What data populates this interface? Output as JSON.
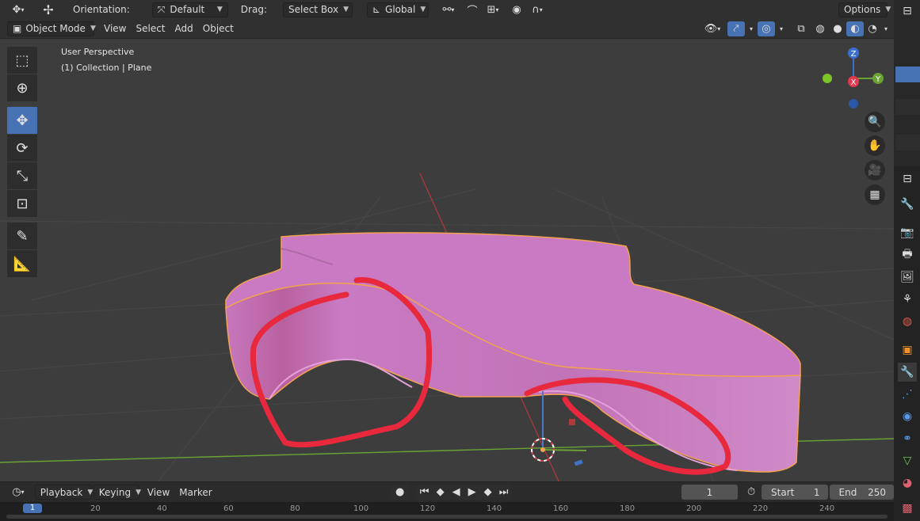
{
  "header": {
    "orientation_label": "Orientation:",
    "orientation_value": "Default",
    "drag_label": "Drag:",
    "drag_value": "Select Box",
    "transform_value": "Global",
    "options_label": "Options"
  },
  "mode_header": {
    "mode_value": "Object Mode",
    "menus": [
      "View",
      "Select",
      "Add",
      "Object"
    ]
  },
  "viewport": {
    "view_name": "User Perspective",
    "selection_info": "(1) Collection | Plane",
    "gizmo_axes": [
      "Z",
      "Y",
      "X"
    ]
  },
  "toolbar": {
    "tools": [
      "select-box",
      "cursor",
      "move",
      "rotate",
      "scale",
      "transform",
      "annotate",
      "measure"
    ],
    "active_tool": "move"
  },
  "timeline": {
    "menus": [
      "Playback",
      "Keying",
      "View",
      "Marker"
    ],
    "current_frame": "1",
    "start_label": "Start",
    "start_value": "1",
    "end_label": "End",
    "end_value": "250",
    "ruler_ticks": [
      "1",
      "20",
      "40",
      "60",
      "80",
      "100",
      "120",
      "140",
      "160",
      "180",
      "200",
      "220",
      "240"
    ]
  },
  "colors": {
    "object": "#c97ac2",
    "outline": "#f5a04a",
    "annotation": "#e8283c",
    "accent": "#4772b3"
  }
}
